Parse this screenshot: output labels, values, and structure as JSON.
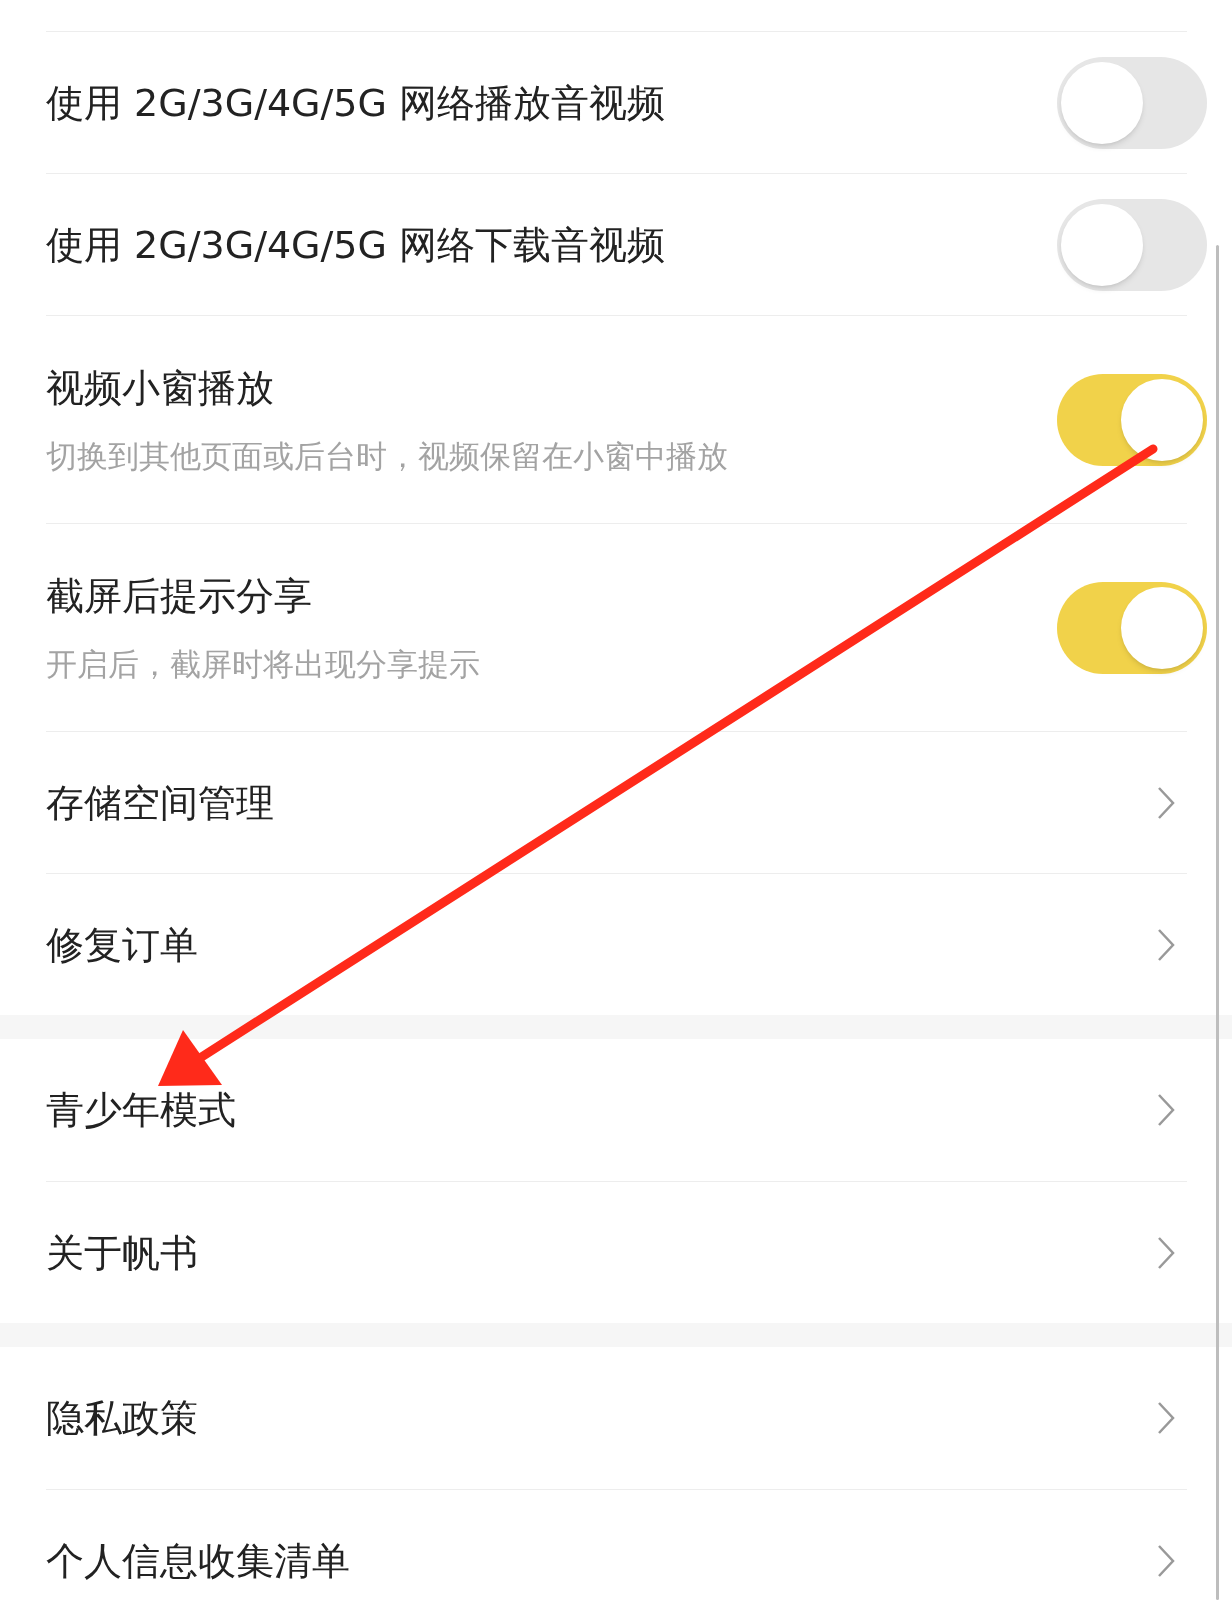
{
  "groups": [
    {
      "items": [
        {
          "kind": "toggle",
          "title": "使用 2G/3G/4G/5G 网络播放音视频",
          "on": false
        },
        {
          "kind": "toggle",
          "title": "使用 2G/3G/4G/5G 网络下载音视频",
          "on": false
        },
        {
          "kind": "toggle",
          "title": "视频小窗播放",
          "subtitle": "切换到其他页面或后台时，视频保留在小窗中播放",
          "on": true
        },
        {
          "kind": "toggle",
          "title": "截屏后提示分享",
          "subtitle": "开启后，截屏时将出现分享提示",
          "on": true
        },
        {
          "kind": "link",
          "title": "存储空间管理"
        },
        {
          "kind": "link",
          "title": "修复订单"
        }
      ]
    },
    {
      "items": [
        {
          "kind": "link",
          "title": "青少年模式"
        },
        {
          "kind": "link",
          "title": "关于帆书"
        }
      ]
    },
    {
      "items": [
        {
          "kind": "link",
          "title": "隐私政策"
        },
        {
          "kind": "link",
          "title": "个人信息收集清单"
        }
      ]
    }
  ]
}
